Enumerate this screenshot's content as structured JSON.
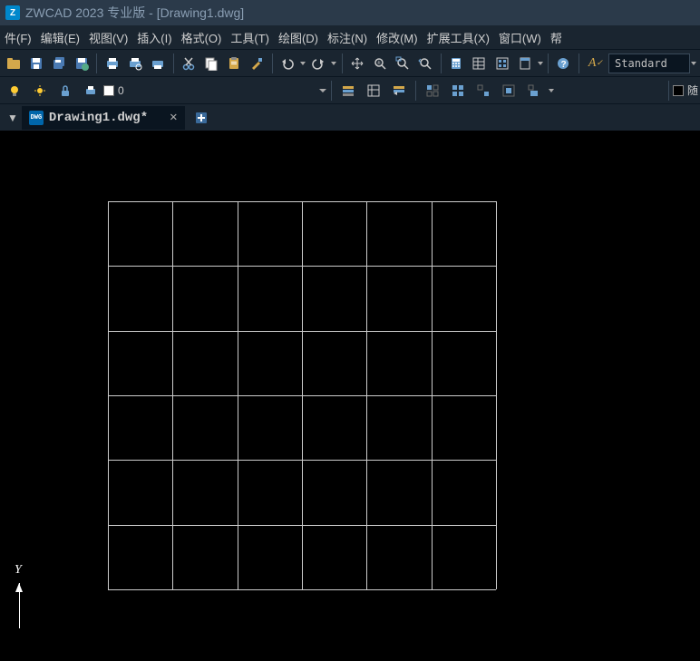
{
  "title": "ZWCAD 2023 专业版 - [Drawing1.dwg]",
  "menu": {
    "file": "件(F)",
    "edit": "编辑(E)",
    "view": "视图(V)",
    "insert": "插入(I)",
    "format": "格式(O)",
    "tools": "工具(T)",
    "draw": "绘图(D)",
    "annotate": "标注(N)",
    "modify": "修改(M)",
    "extension": "扩展工具(X)",
    "window": "窗口(W)",
    "help": "帮"
  },
  "toolbar": {
    "style": "Standard",
    "layer_zero": "0",
    "following": "随"
  },
  "tabs": {
    "current": "Drawing1.dwg*",
    "close": "✕"
  },
  "ucs": {
    "y": "Y"
  }
}
